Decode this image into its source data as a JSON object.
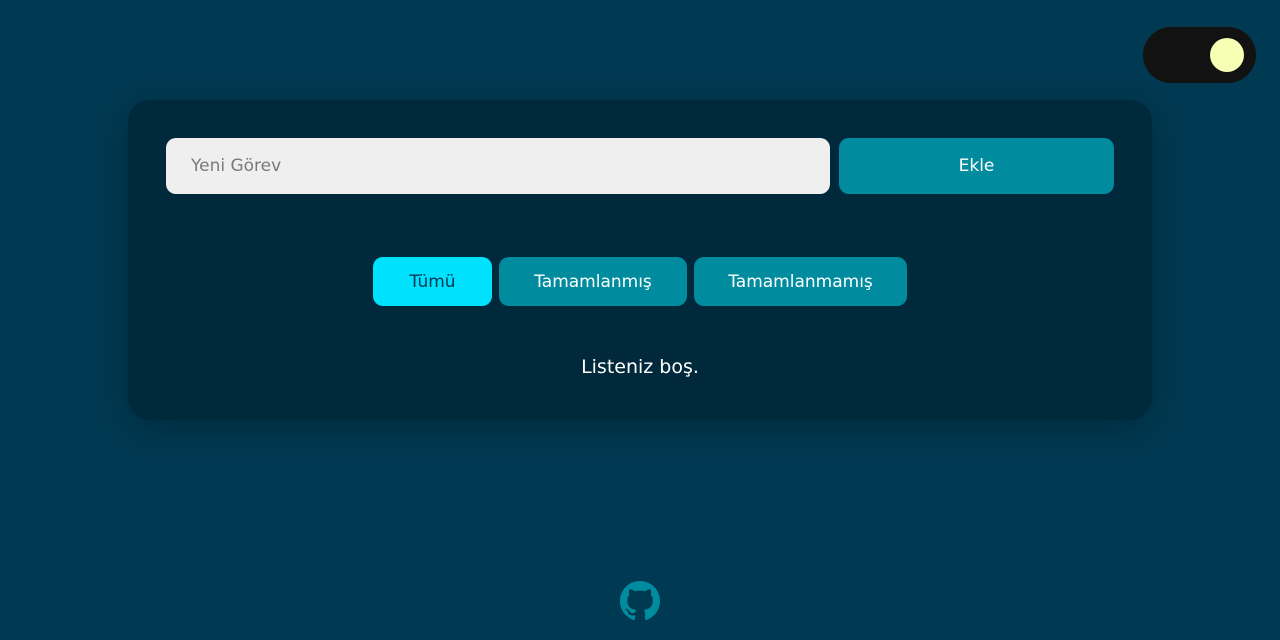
{
  "theme_toggle": {
    "state": "dark",
    "track_color": "#121212",
    "knob_color": "#f6ffb4"
  },
  "todo": {
    "input": {
      "placeholder": "Yeni Görev",
      "value": ""
    },
    "add_button_label": "Ekle",
    "filters": [
      {
        "label": "Tümü",
        "active": true
      },
      {
        "label": "Tamamlanmış",
        "active": false
      },
      {
        "label": "Tamamlanmamış",
        "active": false
      }
    ],
    "empty_message": "Listeniz boş."
  },
  "footer": {
    "icon": "github-icon"
  },
  "colors": {
    "background": "#003a52",
    "card": "#002a3c",
    "button": "#008c9e",
    "button_active": "#00e1fd"
  }
}
